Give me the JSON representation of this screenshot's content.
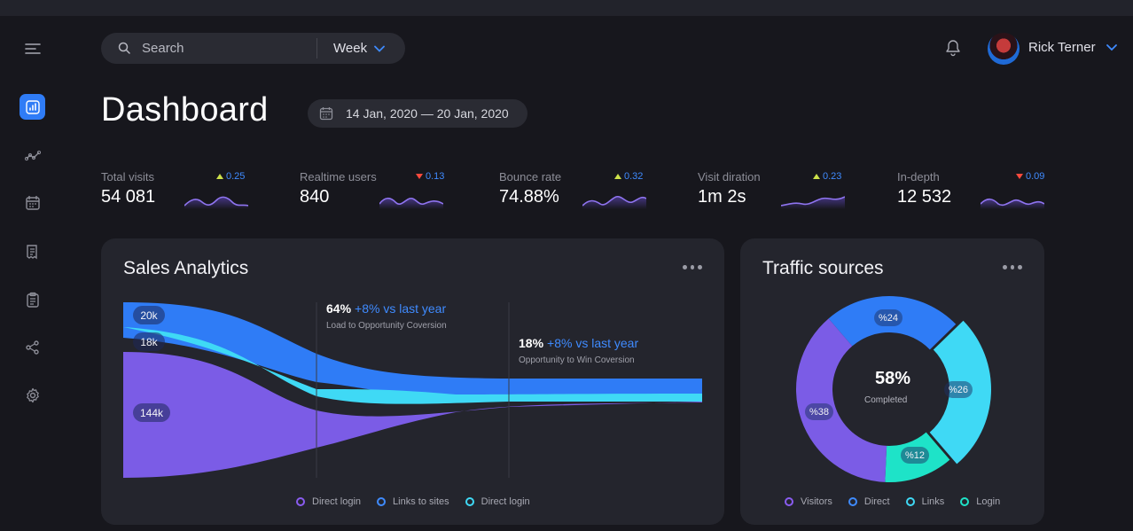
{
  "search": {
    "placeholder": "Search",
    "period": "Week"
  },
  "user": {
    "name": "Rick Terner"
  },
  "page": {
    "title": "Dashboard",
    "date_range": "14 Jan, 2020 — 20 Jan, 2020"
  },
  "kpis": [
    {
      "label": "Total visits",
      "value": "54 081",
      "delta": "0.25",
      "trend": "up"
    },
    {
      "label": "Realtime users",
      "value": "840",
      "delta": "0.13",
      "trend": "down"
    },
    {
      "label": "Bounce rate",
      "value": "74.88%",
      "delta": "0.32",
      "trend": "up"
    },
    {
      "label": "Visit diration",
      "value": "1m 2s",
      "delta": "0.23",
      "trend": "up"
    },
    {
      "label": "In-depth",
      "value": "12 532",
      "delta": "0.09",
      "trend": "down"
    }
  ],
  "sales": {
    "title": "Sales Analytics",
    "flows": [
      {
        "label": "20k",
        "color": "#2f7cf6"
      },
      {
        "label": "18k",
        "color": "#3fd9f5"
      },
      {
        "label": "144k",
        "color": "#7b5ce6"
      }
    ],
    "stages": [
      {
        "pct": "64%",
        "delta": "+8% vs last year",
        "desc": "Load to Opportunity Coversion"
      },
      {
        "pct": "18%",
        "delta": "+8% vs last year",
        "desc": "Opportunity to Win Coversion"
      }
    ],
    "legend": [
      {
        "label": "Direct login",
        "color": "#8a5cf0"
      },
      {
        "label": "Links to sites",
        "color": "#3f8bff"
      },
      {
        "label": "Direct login",
        "color": "#3fd9f5"
      }
    ]
  },
  "traffic": {
    "title": "Traffic sources",
    "center_value": "58%",
    "center_label": "Completed",
    "segments": [
      {
        "name": "Direct",
        "label": "%24",
        "value": 24,
        "color": "#2f7cf6"
      },
      {
        "name": "Links",
        "label": "%26",
        "value": 26,
        "color": "#3fd9f5"
      },
      {
        "name": "Login",
        "label": "%12",
        "value": 12,
        "color": "#1ee3c8"
      },
      {
        "name": "Visitors",
        "label": "%38",
        "value": 38,
        "color": "#7b5ce6"
      }
    ],
    "legend": [
      {
        "label": "Visitors",
        "color": "#8a5cf0"
      },
      {
        "label": "Direct",
        "color": "#3f8bff"
      },
      {
        "label": "Links",
        "color": "#3fd9f5"
      },
      {
        "label": "Login",
        "color": "#1ee3c8"
      }
    ]
  }
}
